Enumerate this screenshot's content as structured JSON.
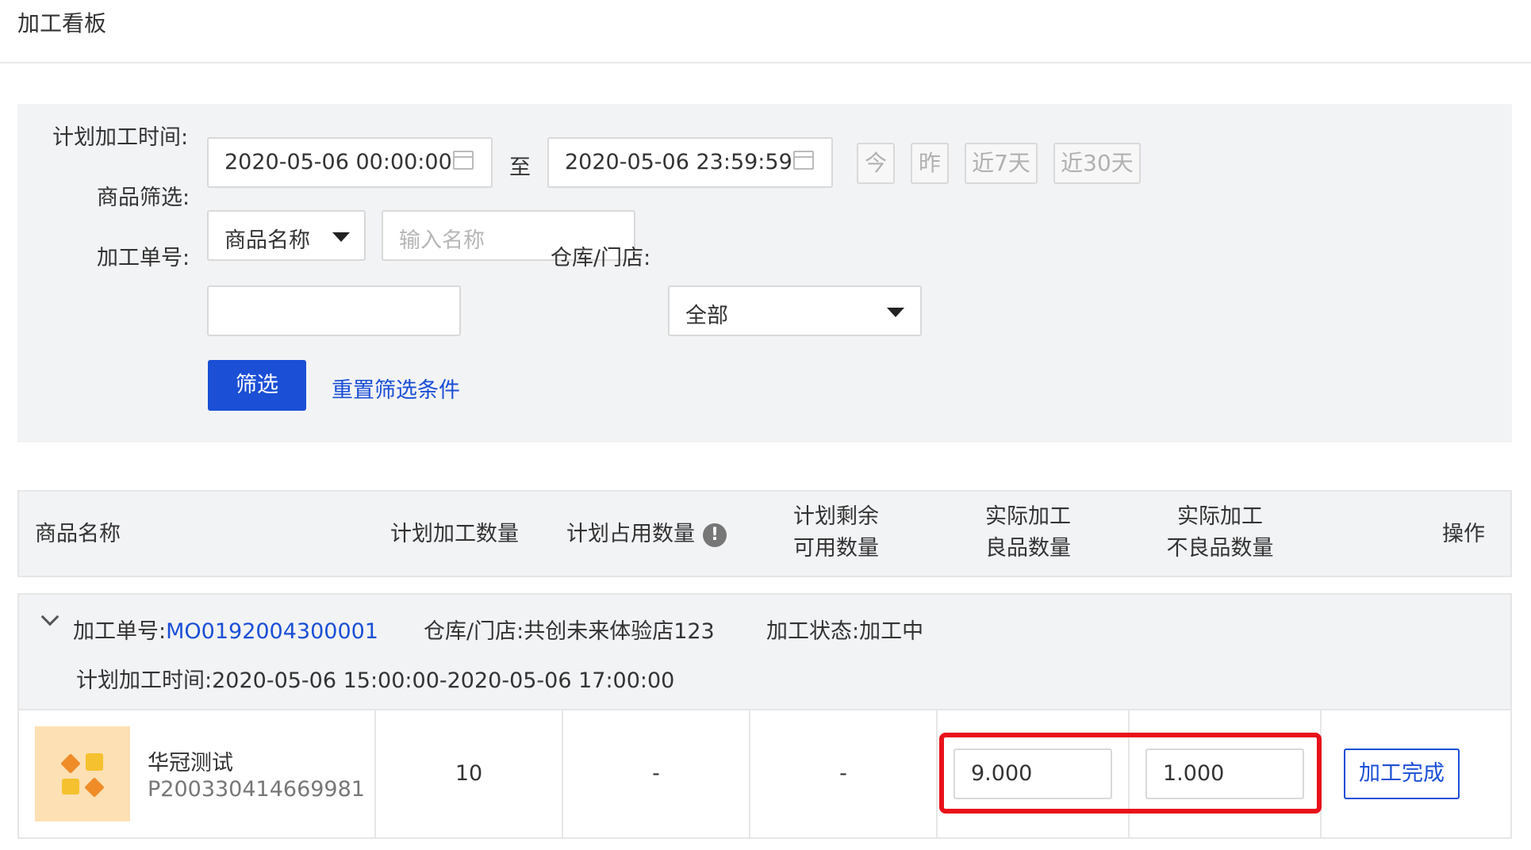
{
  "page_title": "加工看板",
  "filters": {
    "plan_time_label": "计划加工时间:",
    "start_time": "2020-05-06 00:00:00",
    "to_label": "至",
    "end_time": "2020-05-06 23:59:59",
    "quick_ranges": [
      "今",
      "昨",
      "近7天",
      "近30天"
    ],
    "product_filter_label": "商品筛选:",
    "product_filter_type": "商品名称",
    "product_name_placeholder": "输入名称",
    "order_no_label": "加工单号:",
    "order_no_value": "",
    "warehouse_label": "仓库/门店:",
    "warehouse_value": "全部",
    "filter_button": "筛选",
    "reset_link": "重置筛选条件"
  },
  "table": {
    "headers": {
      "product_name": "商品名称",
      "plan_qty": "计划加工数量",
      "plan_occupied": "计划占用数量",
      "plan_remaining_line1": "计划剩余",
      "plan_remaining_line2": "可用数量",
      "actual_good_line1": "实际加工",
      "actual_good_line2": "良品数量",
      "actual_bad_line1": "实际加工",
      "actual_bad_line2": "不良品数量",
      "actions": "操作"
    },
    "group": {
      "order_label": "加工单号:",
      "order_no": "MO0192004300001",
      "warehouse_label": "仓库/门店:",
      "warehouse": "共创未来体验店123",
      "status_label": "加工状态:",
      "status": "加工中",
      "plan_time_label": "计划加工时间:",
      "plan_time": "2020-05-06 15:00:00-2020-05-06 17:00:00"
    },
    "rows": [
      {
        "product_name": "华冠测试",
        "product_code": "P200330414669981",
        "plan_qty": "10",
        "plan_occupied": "-",
        "plan_remaining": "-",
        "actual_good": "9.000",
        "actual_bad": "1.000",
        "action": "加工完成"
      }
    ]
  },
  "colors": {
    "primary": "#1a4fd6",
    "highlight": "#e8101a",
    "panel_bg": "#f2f3f5"
  }
}
